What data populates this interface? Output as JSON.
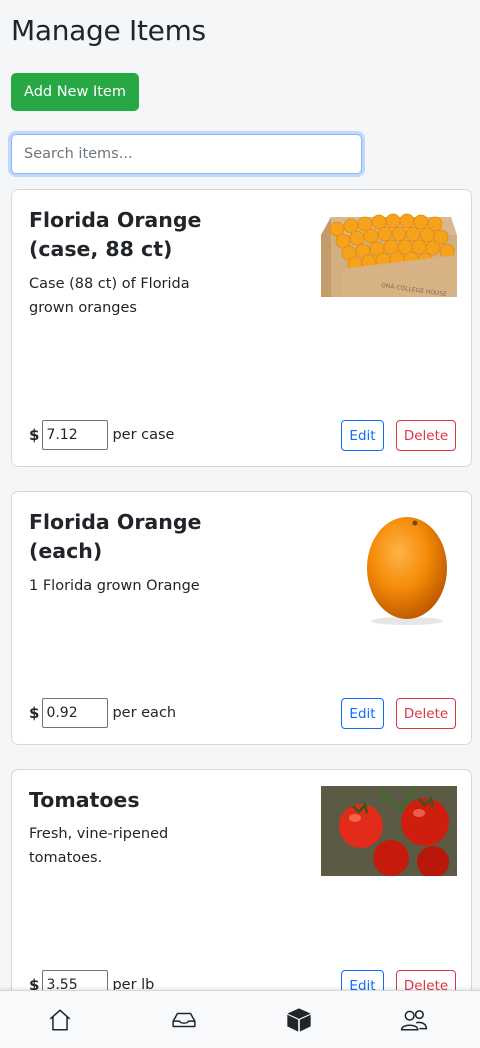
{
  "header": {
    "title": "Manage Items"
  },
  "toolbar": {
    "add_label": "Add New Item"
  },
  "search": {
    "placeholder": "Search items..."
  },
  "items": [
    {
      "title": "Florida Orange (case, 88 ct)",
      "description": "Case (88 ct) of Florida grown oranges",
      "currency": "$",
      "price": "7.12",
      "unit": "per case",
      "image": "orange-case-image",
      "edit_label": "Edit",
      "delete_label": "Delete"
    },
    {
      "title": "Florida Orange (each)",
      "description": "1 Florida grown Orange",
      "currency": "$",
      "price": "0.92",
      "unit": "per each",
      "image": "single-orange-image",
      "edit_label": "Edit",
      "delete_label": "Delete"
    },
    {
      "title": "Tomatoes",
      "description": "Fresh, vine-ripened tomatoes.",
      "currency": "$",
      "price": "3.55",
      "unit": "per lb",
      "image": "tomatoes-image",
      "edit_label": "Edit",
      "delete_label": "Delete"
    }
  ],
  "nav": {
    "items": [
      "home-icon",
      "inbox-icon",
      "box-icon",
      "users-icon"
    ],
    "active": "box-icon"
  },
  "colors": {
    "primary": "#0d6efd",
    "success": "#28a745",
    "danger": "#dc3545"
  }
}
